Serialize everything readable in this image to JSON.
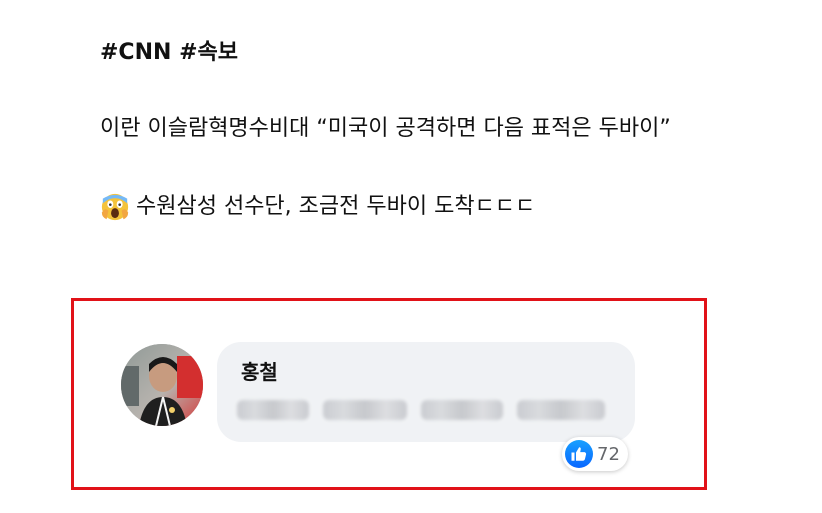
{
  "post": {
    "hashtags": "#CNN #속보",
    "headline": "이란 이슬람혁명수비대 “미국이 공격하면 다음 표적은 두바이”",
    "update_text": "수원삼성 선수단, 조금전 두바이 도착ㄷㄷㄷ",
    "emoji_icon": "screaming-face-icon"
  },
  "comment": {
    "author": "홍철",
    "reaction_count": "72",
    "reaction_icon": "like-icon"
  },
  "colors": {
    "highlight_border": "#e11218",
    "bubble_background": "#f0f2f5",
    "like_blue": "#0866ff"
  }
}
